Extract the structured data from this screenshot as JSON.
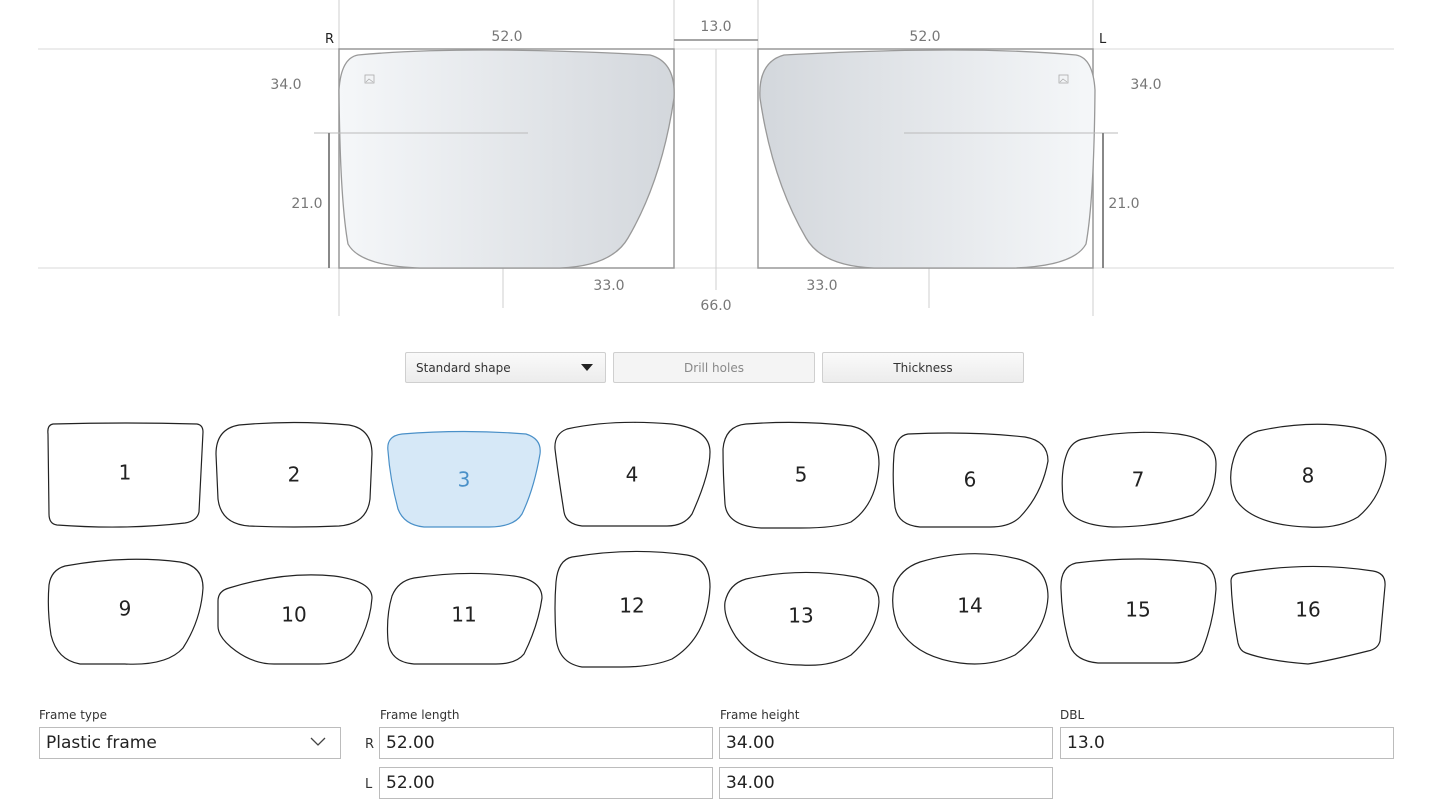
{
  "diagram": {
    "side_right": "R",
    "side_left": "L",
    "lens_width_right": "52.0",
    "lens_width_left": "52.0",
    "bridge": "13.0",
    "lens_height_right": "34.0",
    "lens_height_left": "34.0",
    "fitting_height_right": "21.0",
    "fitting_height_left": "21.0",
    "pd_right": "33.0",
    "pd_left": "33.0",
    "pd_total": "66.0"
  },
  "toolbar": {
    "shape_select": "Standard shape",
    "drill_holes": "Drill holes",
    "thickness": "Thickness"
  },
  "shapes": {
    "selected": "3",
    "items": [
      "1",
      "2",
      "3",
      "4",
      "5",
      "6",
      "7",
      "8",
      "9",
      "10",
      "11",
      "12",
      "13",
      "14",
      "15",
      "16"
    ]
  },
  "form": {
    "frame_type_label": "Frame type",
    "frame_type_value": "Plastic frame",
    "frame_length_label": "Frame length",
    "frame_height_label": "Frame height",
    "dbl_label": "DBL",
    "row_r": "R",
    "row_l": "L",
    "frame_length_r": "52.00",
    "frame_length_l": "52.00",
    "frame_height_r": "34.00",
    "frame_height_l": "34.00",
    "dbl_value": "13.0"
  },
  "colors": {
    "accent": "#4a90c8",
    "selected_fill": "#d6e8f7",
    "lens_gradient_start": "#f4f6f8",
    "lens_gradient_end": "#d2d6db"
  }
}
